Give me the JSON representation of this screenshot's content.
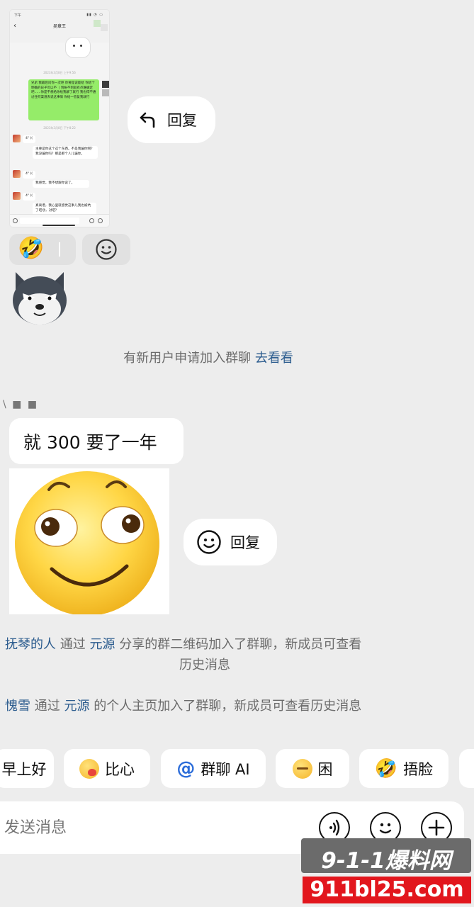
{
  "embedded_screenshot": {
    "status_left": "下午",
    "title": "吴章王",
    "timestamp_1": "2023年3月8日 上午9:56",
    "green_message": "兄弟 我最后问你一次吧 你要是说能给 你给个明确的日子可以不（ 到帐不到就有点难确定吧……你是不想给你给我解了就行 我也得不通过任何渠道去说这事情 你给一答复我就行",
    "timestamp_2": "2023年3月8日 下午8:22",
    "voice_1": "4\" ((",
    "reply_1": "主要是你这个这个东西。不是我骗你啊？我没骗你吗？那是那个人儿骗你。",
    "voice_2": "4\" ((",
    "reply_2": "我感觉，我不想跟你说了。",
    "voice_3": "4\" ((",
    "reply_3": "真离谱，我心里就感觉这事儿我也被坑了吧😓，对吧？"
  },
  "reply_button_1": {
    "label": "回复"
  },
  "reaction_bar": {
    "emoji": "🤣"
  },
  "system_notice_1": {
    "text": "有新用户申请加入群聊",
    "link": "去看看"
  },
  "sender_name": "\\ ■ ■",
  "message_text": "就 300 要了一年",
  "reply_button_2": {
    "label": "回复"
  },
  "join_notice_1": {
    "user": "抚琴的人",
    "via": "通过",
    "sharer": "元源",
    "rest": "分享的群二维码加入了群聊，新成员可查看",
    "line2": "历史消息"
  },
  "join_notice_2": {
    "user": "愧雪",
    "via": "通过",
    "sharer": "元源",
    "rest": "的个人主页加入了群聊，新成员可查看历史消息"
  },
  "quick_chips": [
    {
      "label": "早上好",
      "icon": ""
    },
    {
      "label": "比心",
      "icon": "heart-hands-emoji"
    },
    {
      "label": "群聊 AI",
      "icon": "@"
    },
    {
      "label": "困",
      "icon": "sleepy-emoji"
    },
    {
      "label": "捂脸",
      "icon": "facepalm-emoji"
    }
  ],
  "input": {
    "placeholder": "发送消息"
  },
  "watermark": {
    "top": "9-1-1爆料网",
    "bottom": "911bl25.com"
  },
  "colors": {
    "background": "#ededed",
    "link": "#2d5d8f",
    "green_bubble": "#95ec69",
    "watermark_red": "#e2161d"
  }
}
